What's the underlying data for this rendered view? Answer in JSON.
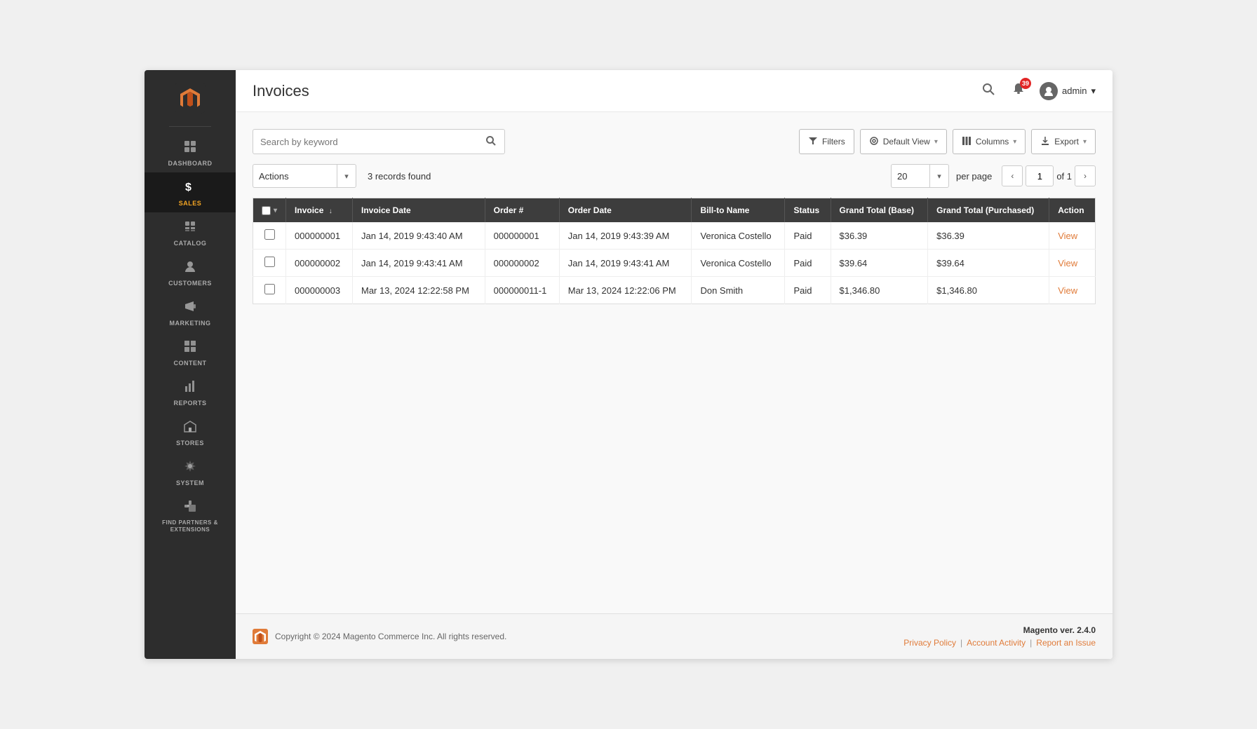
{
  "sidebar": {
    "logo_alt": "Magento Logo",
    "items": [
      {
        "id": "dashboard",
        "label": "DASHBOARD",
        "icon": "⊞",
        "active": false
      },
      {
        "id": "sales",
        "label": "SALES",
        "icon": "$",
        "active": true
      },
      {
        "id": "catalog",
        "label": "CATALOG",
        "icon": "🏷",
        "active": false
      },
      {
        "id": "customers",
        "label": "CUSTOMERS",
        "icon": "👤",
        "active": false
      },
      {
        "id": "marketing",
        "label": "MARKETING",
        "icon": "📣",
        "active": false
      },
      {
        "id": "content",
        "label": "CONTENT",
        "icon": "▦",
        "active": false
      },
      {
        "id": "reports",
        "label": "REPORTS",
        "icon": "📊",
        "active": false
      },
      {
        "id": "stores",
        "label": "STORES",
        "icon": "🏪",
        "active": false
      },
      {
        "id": "system",
        "label": "SYSTEM",
        "icon": "⚙",
        "active": false
      },
      {
        "id": "extensions",
        "label": "FIND PARTNERS & EXTENSIONS",
        "icon": "🧩",
        "active": false
      }
    ]
  },
  "header": {
    "page_title": "Invoices",
    "notification_count": "39",
    "admin_label": "admin",
    "admin_caret": "▾"
  },
  "toolbar": {
    "search_placeholder": "Search by keyword",
    "filters_label": "Filters",
    "default_view_label": "Default View",
    "columns_label": "Columns",
    "export_label": "Export"
  },
  "actions_bar": {
    "actions_label": "Actions",
    "records_found": "3 records found",
    "per_page_value": "20",
    "per_page_label": "per page",
    "page_current": "1",
    "page_total": "of 1"
  },
  "table": {
    "columns": [
      {
        "id": "invoice",
        "label": "Invoice",
        "sortable": true
      },
      {
        "id": "invoice_date",
        "label": "Invoice Date",
        "sortable": false
      },
      {
        "id": "order_num",
        "label": "Order #",
        "sortable": false
      },
      {
        "id": "order_date",
        "label": "Order Date",
        "sortable": false
      },
      {
        "id": "bill_to_name",
        "label": "Bill-to Name",
        "sortable": false
      },
      {
        "id": "status",
        "label": "Status",
        "sortable": false
      },
      {
        "id": "grand_total_base",
        "label": "Grand Total (Base)",
        "sortable": false
      },
      {
        "id": "grand_total_purchased",
        "label": "Grand Total (Purchased)",
        "sortable": false
      },
      {
        "id": "action",
        "label": "Action",
        "sortable": false
      }
    ],
    "rows": [
      {
        "invoice": "000000001",
        "invoice_date": "Jan 14, 2019 9:43:40 AM",
        "order_num": "000000001",
        "order_date": "Jan 14, 2019 9:43:39 AM",
        "bill_to_name": "Veronica Costello",
        "status": "Paid",
        "grand_total_base": "$36.39",
        "grand_total_purchased": "$36.39",
        "action_label": "View"
      },
      {
        "invoice": "000000002",
        "invoice_date": "Jan 14, 2019 9:43:41 AM",
        "order_num": "000000002",
        "order_date": "Jan 14, 2019 9:43:41 AM",
        "bill_to_name": "Veronica Costello",
        "status": "Paid",
        "grand_total_base": "$39.64",
        "grand_total_purchased": "$39.64",
        "action_label": "View"
      },
      {
        "invoice": "000000003",
        "invoice_date": "Mar 13, 2024 12:22:58 PM",
        "order_num": "000000011-1",
        "order_date": "Mar 13, 2024 12:22:06 PM",
        "bill_to_name": "Don Smith",
        "status": "Paid",
        "grand_total_base": "$1,346.80",
        "grand_total_purchased": "$1,346.80",
        "action_label": "View"
      }
    ]
  },
  "footer": {
    "copyright": "Copyright © 2024 Magento Commerce Inc. All rights reserved.",
    "version_label": "Magento",
    "version_number": "ver. 2.4.0",
    "privacy_policy_label": "Privacy Policy",
    "account_activity_label": "Account Activity",
    "report_issue_label": "Report an Issue"
  }
}
